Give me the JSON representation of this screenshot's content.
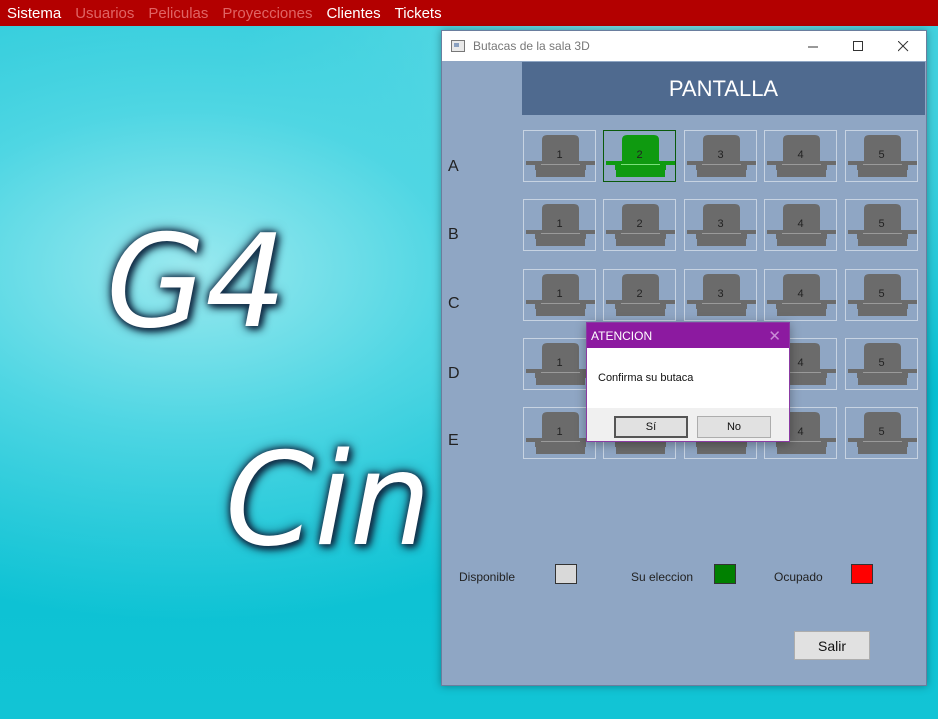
{
  "menu": [
    {
      "label": "Sistema",
      "enabled": true
    },
    {
      "label": "Usuarios",
      "enabled": false
    },
    {
      "label": "Peliculas",
      "enabled": false
    },
    {
      "label": "Proyecciones",
      "enabled": false
    },
    {
      "label": "Clientes",
      "enabled": true
    },
    {
      "label": "Tickets",
      "enabled": true
    }
  ],
  "background": {
    "logo_line1": "G4",
    "logo_line2": "Cin"
  },
  "window": {
    "title": "Butacas de la sala 3D",
    "screen_label": "PANTALLA",
    "rows": [
      "A",
      "B",
      "C",
      "D",
      "E"
    ],
    "seat_numbers": [
      "1",
      "2",
      "3",
      "4",
      "5"
    ],
    "selected_seat": {
      "row": "A",
      "number": "2"
    },
    "legend": {
      "available": "Disponible",
      "selected": "Su eleccion",
      "occupied": "Ocupado"
    },
    "exit_label": "Salir"
  },
  "colors": {
    "menu_bg": "#b30000",
    "window_bg": "#8fa6c4",
    "screen_bg": "#4f6a8f",
    "seat_available": "#6b6b6b",
    "seat_selected": "#0f9a10",
    "legend_available": "#d9d9d9",
    "legend_selected": "#008000",
    "legend_occupied": "#ff0000",
    "dialog_title_bg": "#8c1aa0"
  },
  "dialog": {
    "title": "ATENCION",
    "message": "Confirma su butaca",
    "yes_label": "Sí",
    "no_label": "No"
  }
}
